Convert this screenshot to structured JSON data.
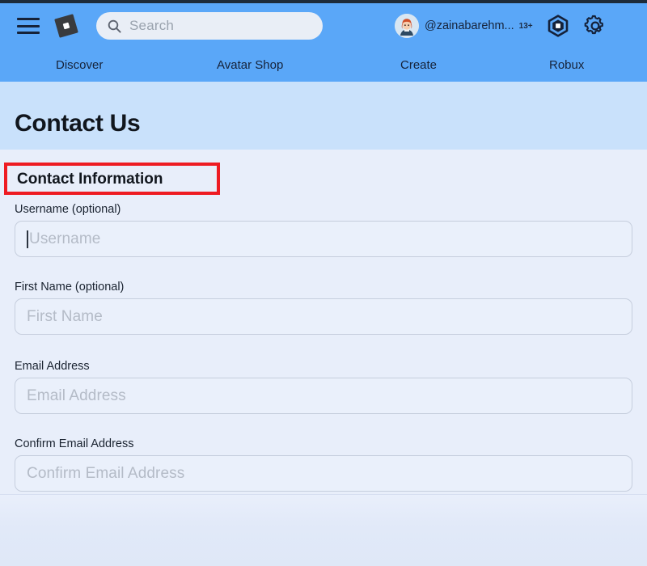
{
  "header": {
    "menu_icon": "hamburger-menu-icon",
    "logo_icon": "roblox-logo-icon",
    "search": {
      "icon": "search-icon",
      "placeholder": "Search",
      "value": ""
    },
    "account": {
      "avatar_icon": "user-avatar-icon",
      "username": "@zainabarehm...",
      "age_badge": "13+",
      "robux_icon": "robux-icon",
      "settings_icon": "gear-icon"
    },
    "nav": [
      {
        "label": "Discover"
      },
      {
        "label": "Avatar Shop"
      },
      {
        "label": "Create"
      },
      {
        "label": "Robux"
      }
    ]
  },
  "page": {
    "title": "Contact Us",
    "section_heading": "Contact Information"
  },
  "form": {
    "fields": [
      {
        "label": "Username (optional)",
        "placeholder": "Username",
        "value": "",
        "focused": true
      },
      {
        "label": "First Name (optional)",
        "placeholder": "First Name",
        "value": "",
        "focused": false
      },
      {
        "label": "Email Address",
        "placeholder": "Email Address",
        "value": "",
        "focused": false
      },
      {
        "label": "Confirm Email Address",
        "placeholder": "Confirm Email Address",
        "value": "",
        "focused": false
      }
    ]
  },
  "annotation": {
    "type": "highlight-rectangle",
    "color": "#ee1b22",
    "target": "Contact Information"
  },
  "colors": {
    "header_blue": "#5aa7f8",
    "hero_band": "#c9e1fb",
    "content_bg": "#e8eefa",
    "input_bg": "#eaf0fb",
    "input_border": "#c6cedd",
    "text_dark": "#11161d",
    "placeholder": "#b4bbc7",
    "annotation_red": "#ee1b22"
  }
}
